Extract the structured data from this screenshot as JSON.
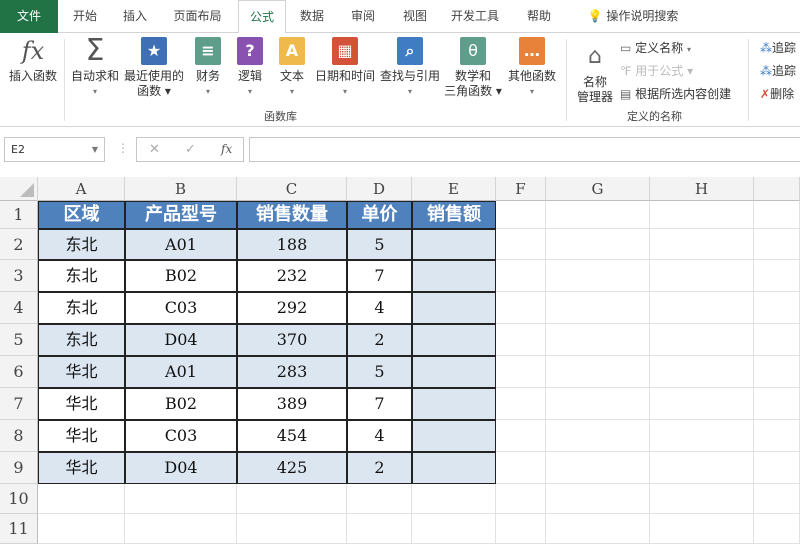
{
  "tabs": [
    "文件",
    "开始",
    "插入",
    "页面布局",
    "公式",
    "数据",
    "审阅",
    "视图",
    "开发工具",
    "帮助"
  ],
  "tell_me": "操作说明搜索",
  "ribbon": {
    "insert_function": "插入函数",
    "autosum": "自动求和",
    "recent_1": "最近使用的",
    "recent_2": "函数",
    "financial": "财务",
    "logical": "逻辑",
    "text": "文本",
    "datetime": "日期和时间",
    "lookup": "查找与引用",
    "math_1": "数学和",
    "math_2": "三角函数",
    "other": "其他函数",
    "group_library": "函数库",
    "name_mgr_1": "名称",
    "name_mgr_2": "管理器",
    "define_name": "定义名称",
    "use_in_formula": "用于公式",
    "create_from_sel": "根据所选内容创建",
    "group_names": "定义的名称",
    "trace_prec": "追踪",
    "trace_dep": "追踪",
    "remove_arrows": "删除"
  },
  "formula_bar": {
    "name_box": "E2",
    "fx": "fx",
    "value": ""
  },
  "columns": [
    "A",
    "B",
    "C",
    "D",
    "E",
    "F",
    "G",
    "H"
  ],
  "rows": [
    "1",
    "2",
    "3",
    "4",
    "5",
    "6",
    "7",
    "8",
    "9",
    "10",
    "11"
  ],
  "table": {
    "headers": [
      "区域",
      "产品型号",
      "销售数量",
      "单价",
      "销售额"
    ],
    "data": [
      [
        "东北",
        "A01",
        "188",
        "5",
        ""
      ],
      [
        "东北",
        "B02",
        "232",
        "7",
        ""
      ],
      [
        "东北",
        "C03",
        "292",
        "4",
        ""
      ],
      [
        "东北",
        "D04",
        "370",
        "2",
        ""
      ],
      [
        "华北",
        "A01",
        "283",
        "5",
        ""
      ],
      [
        "华北",
        "B02",
        "389",
        "7",
        ""
      ],
      [
        "华北",
        "C03",
        "454",
        "4",
        ""
      ],
      [
        "华北",
        "D04",
        "425",
        "2",
        ""
      ]
    ]
  }
}
